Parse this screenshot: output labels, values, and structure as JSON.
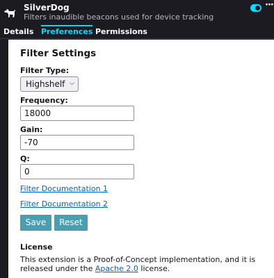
{
  "extension": {
    "name": "SilverDog",
    "description": "Filters inaudible beacons used for device tracking",
    "icon": "dog-icon",
    "enabled": true
  },
  "tabs": [
    {
      "label": "Details",
      "active": false
    },
    {
      "label": "Preferences",
      "active": true
    },
    {
      "label": "Permissions",
      "active": false
    }
  ],
  "settings": {
    "title": "Filter Settings",
    "filter_type_label": "Filter Type:",
    "filter_type_value": "Highshelf",
    "frequency_label": "Frequency:",
    "frequency_value": "18000",
    "gain_label": "Gain:",
    "gain_value": "-70",
    "q_label": "Q:",
    "q_value": "0",
    "doc_link_1": "Filter Documentation 1",
    "doc_link_2": "Filter Documentation 2",
    "save_label": "Save",
    "reset_label": "Reset"
  },
  "license": {
    "title": "License",
    "text_before": "This extension is a Proof-of-Concept implementation, and it is released under the ",
    "link": "Apache 2.0",
    "text_after": " license."
  },
  "colors": {
    "accent": "#00ddff",
    "button": "#4a9eaf",
    "link": "#0060df",
    "header_bg": "#1c1b22"
  }
}
